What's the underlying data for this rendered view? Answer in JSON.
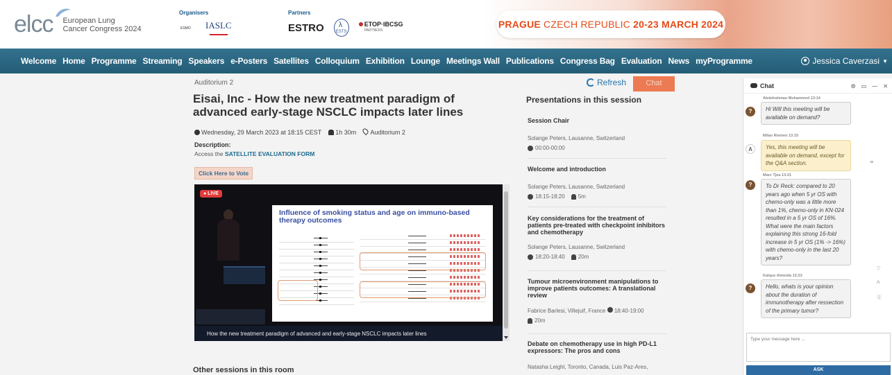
{
  "header": {
    "logo_text": "elcc",
    "logo_sub1": "European Lung",
    "logo_sub2": "Cancer Congress 2024",
    "organisers_label": "Organisers",
    "partners_label": "Partners",
    "org_esmo": "ESMO",
    "org_iaslc": "IASLC",
    "partner_estro": "ESTRO",
    "partner_ests": "ESTS",
    "partner_etop": "ETOP·IBCSG",
    "partner_etop_sub": "PARTNERS",
    "banner_city": "PRAGUE",
    "banner_country": " CZECH REPUBLIC ",
    "banner_dates": "20-23 MARCH 2024"
  },
  "nav": {
    "items": [
      "Welcome",
      "Home",
      "Programme",
      "Streaming",
      "Speakers",
      "e-Posters",
      "Satellites",
      "Colloquium",
      "Exhibition",
      "Lounge",
      "Meetings Wall",
      "Publications",
      "Congress Bag",
      "Evaluation",
      "News",
      "myProgramme"
    ],
    "user_name": "Jessica Caverzasi"
  },
  "main": {
    "breadcrumb": "Auditorium 2",
    "title": "Eisai, Inc - How the new treatment paradigm of advanced early-stage NSCLC impacts later lines",
    "date": "Wednesday, 29 March 2023 at 18:15 CEST",
    "duration": "1h 30m",
    "location": "Auditorium 2",
    "description_label": "Description:",
    "description_text": "Access the ",
    "description_link": "SATELLITE EVALUATION FORM",
    "vote_button": "Click Here to Vote",
    "other_sessions": "Other sessions in this room"
  },
  "video": {
    "live_label": "● LIVE",
    "slide_title": "Influence of smoking status and age on immuno-based therapy outcomes",
    "caption": "How the new treatment paradigm of advanced and early-stage NSCLC impacts later lines"
  },
  "session_panel": {
    "refresh_label": "Refresh",
    "chat_toggle": "Chat",
    "heading": "Presentations in this session",
    "items": [
      {
        "title": "Session Chair",
        "speaker": "Solange Peters, Lausanne, Switzerland",
        "time": "00:00-00:00",
        "duration": ""
      },
      {
        "title": "Welcome and introduction",
        "speaker": "Solange Peters, Lausanne, Switzerland",
        "time": "18:15-18:20",
        "duration": "5m"
      },
      {
        "title": "Key considerations for the treatment of patients pre-treated with checkpoint inhibitors and chemotherapy",
        "speaker": "Solange Peters, Lausanne, Switzerland",
        "time": "18:20-18:40",
        "duration": "20m"
      },
      {
        "title": "Tumour microenvironment manipulations to improve patients outcomes: A translational review",
        "speaker": "Fabrice Barlesi, Villejuif, France",
        "time": "18:40-19:00",
        "duration": "20m"
      },
      {
        "title": "Debate on chemotherapy use in high PD-L1 expressors: The pros and cons",
        "speaker": "Natasha Leighl, Toronto, Canada, Luis Paz-Ares,",
        "time": "",
        "duration": ""
      }
    ]
  },
  "chat": {
    "title": "Chat",
    "messages": [
      {
        "author": "Abdelrahman Mohammed",
        "time": "13:14",
        "avatar": "?",
        "text": "Hi Will this meeting will be available on demand?",
        "style": "grey"
      },
      {
        "author": "Milan Riemen",
        "time": "13:15",
        "avatar": "A",
        "text": "Yes, this meeting will be available on demand, except for the Q&A section.",
        "style": "yellow"
      },
      {
        "author": "Marc Tjea",
        "time": "13:21",
        "avatar": "?",
        "text": "To Dr Reck: compared to 20 years ago when 5 yr OS with chemo-only was a little more than 1%, chemo-only in KN-024 resulted in a 5 yr OS of 16%. What were the main factors explaining this strong 16-fold increase in 5 yr OS (1% -> 16%) with chemo-only in the last 20 years?",
        "style": "grey"
      },
      {
        "author": "Kaique Almeida",
        "time": "13:23",
        "avatar": "?",
        "text": "Hello, whats is your opinion about the duration of immunotherapy after ressection of the primary tumor?",
        "style": "grey"
      }
    ],
    "input_placeholder": "Type your message here ...",
    "ask_button": "ASK"
  }
}
